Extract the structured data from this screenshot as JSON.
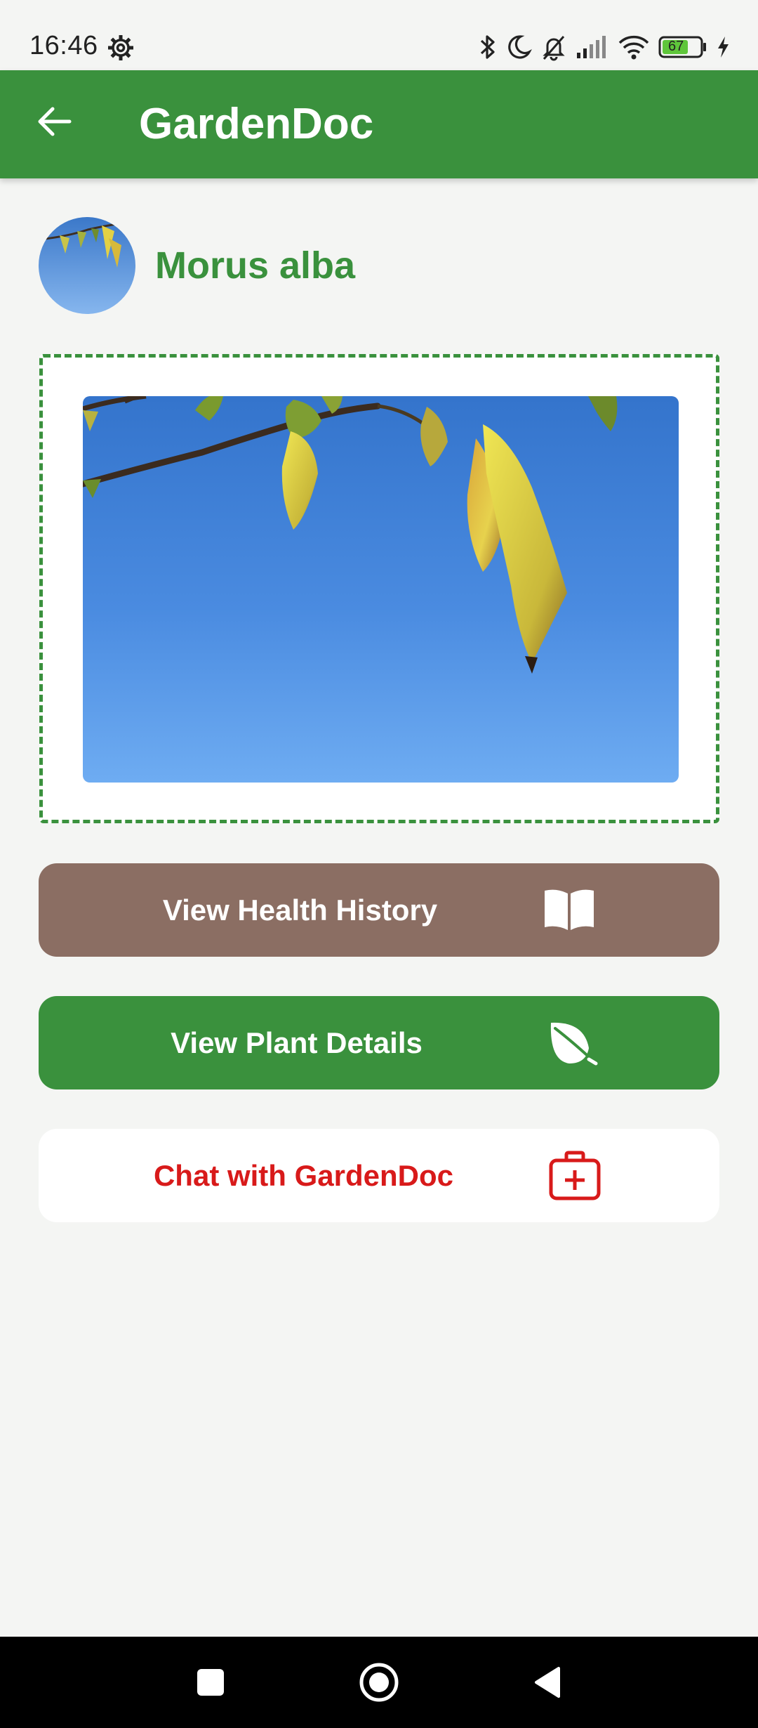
{
  "status_bar": {
    "time": "16:46",
    "battery_level": "67",
    "icons": [
      "settings-gear-icon",
      "bluetooth-icon",
      "do-not-disturb-moon-icon",
      "notifications-off-icon",
      "cellular-signal-icon",
      "wifi-icon",
      "battery-icon",
      "charging-bolt-icon"
    ]
  },
  "app_bar": {
    "title": "GardenDoc",
    "back_icon": "arrow-left-icon"
  },
  "plant": {
    "name": "Morus alba",
    "avatar_icon": "plant-thumbnail",
    "photo": "plant-photo-leaves-blue-sky"
  },
  "actions": {
    "health_history": {
      "label": "View Health History",
      "icon": "open-book-icon"
    },
    "plant_details": {
      "label": "View Plant Details",
      "icon": "leaf-icon"
    },
    "chat": {
      "label": "Chat with GardenDoc",
      "icon": "medical-kit-icon"
    }
  },
  "colors": {
    "primary_green": "#3a913d",
    "brown": "#8b6e63",
    "chat_red": "#d81a1a",
    "background": "#f4f5f3"
  },
  "nav_bar": {
    "icons": [
      "recent-apps-icon",
      "home-icon",
      "back-triangle-icon"
    ]
  }
}
